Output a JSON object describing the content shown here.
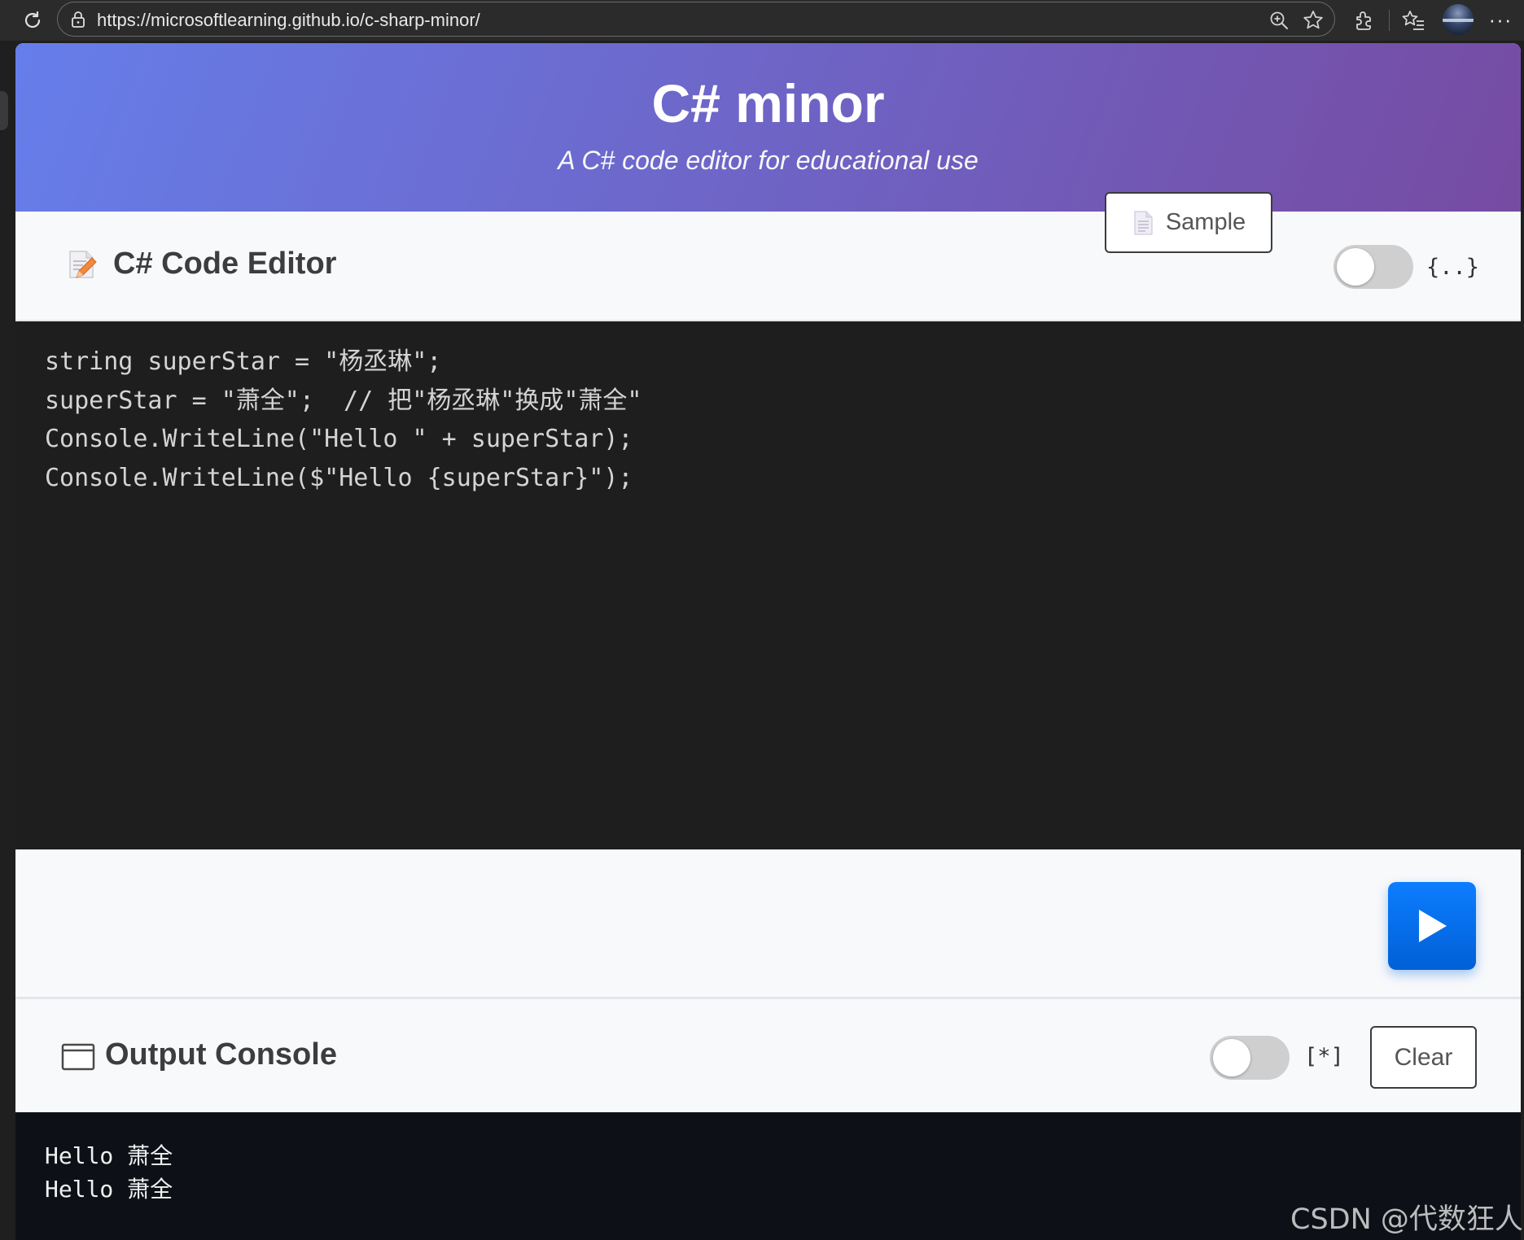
{
  "browser": {
    "url": "https://microsoftlearning.github.io/c-sharp-minor/"
  },
  "header": {
    "title": "C# minor",
    "subtitle": "A C# code editor for educational use"
  },
  "editor": {
    "title": "C# Code Editor",
    "sample_label": "Sample",
    "format_toggle_label": "{..}",
    "format_toggle_on": false,
    "code_lines": [
      "string superStar = \"杨丞琳\";",
      "superStar = \"萧全\";  // 把\"杨丞琳\"换成\"萧全\"",
      "Console.WriteLine(\"Hello \" + superStar);",
      "Console.WriteLine($\"Hello {superStar}\");"
    ]
  },
  "run": {
    "icon": "play-icon"
  },
  "output": {
    "title": "Output Console",
    "toggle_label": "[*]",
    "toggle_on": false,
    "clear_label": "Clear",
    "lines": [
      "Hello 萧全",
      "Hello 萧全"
    ]
  },
  "watermark": "CSDN @代数狂人",
  "colors": {
    "hero_start": "#667eea",
    "hero_end": "#764ba2",
    "run_button": "#0d7dff",
    "code_bg": "#1e1e1e",
    "console_bg": "#0d1117"
  }
}
